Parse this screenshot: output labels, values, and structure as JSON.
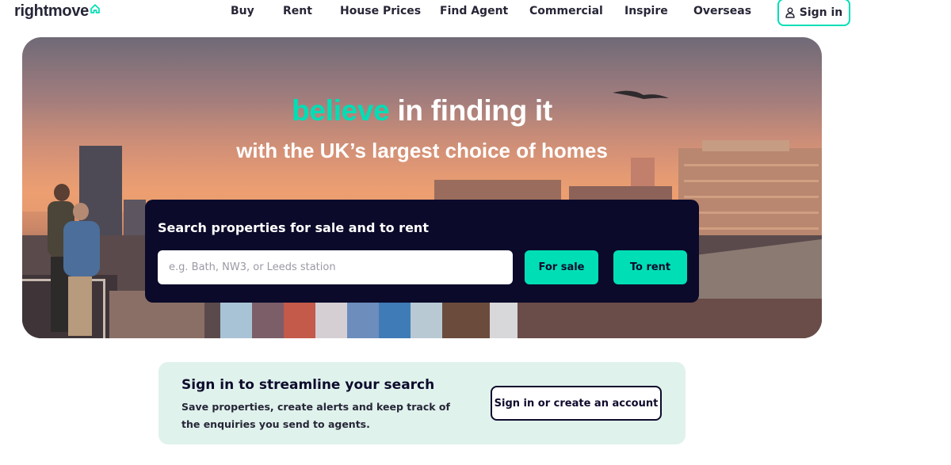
{
  "header": {
    "logo_text": "rightmove",
    "nav": [
      {
        "label": "Buy"
      },
      {
        "label": "Rent"
      },
      {
        "label": "House Prices"
      },
      {
        "label": "Find Agent"
      },
      {
        "label": "Commercial"
      },
      {
        "label": "Inspire"
      },
      {
        "label": "Overseas"
      }
    ],
    "sign_in_label": "Sign in"
  },
  "hero": {
    "headline_accent": "believe",
    "headline_rest": " in finding it",
    "subheadline": "with the UK’s largest choice of homes"
  },
  "search": {
    "title": "Search properties for sale and to rent",
    "placeholder": "e.g. Bath, NW3, or Leeds station",
    "value": "",
    "for_sale_label": "For sale",
    "to_rent_label": "To rent"
  },
  "promo": {
    "title": "Sign in to streamline your search",
    "body": "Save properties, create alerts and keep track of the enquiries you send to agents.",
    "button_label": "Sign in or create an account"
  },
  "colors": {
    "brand_accent": "#00deb6",
    "navy": "#0b0a2a",
    "promo_bg": "#dff2ec"
  },
  "icons": {
    "logo_house": "house-outline-icon",
    "sign_in": "user-icon"
  }
}
